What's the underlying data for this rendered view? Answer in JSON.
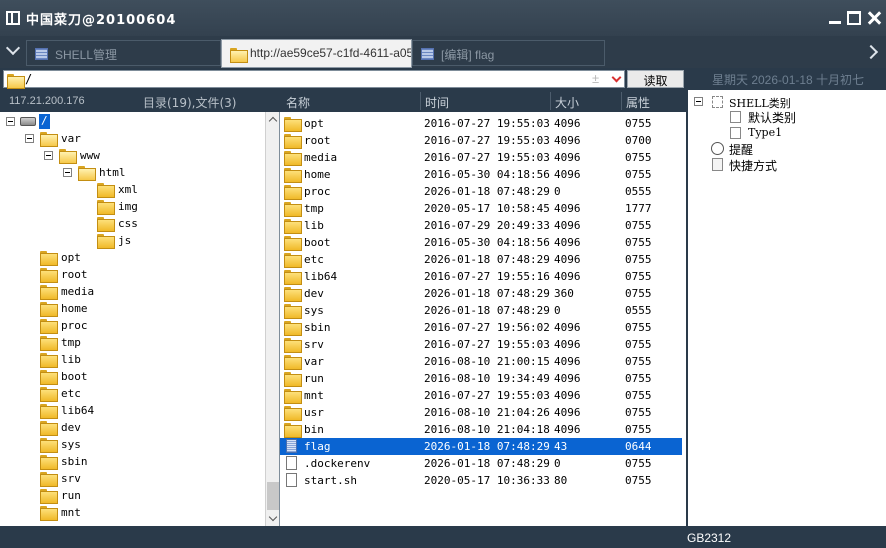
{
  "window": {
    "title": "中国菜刀@20100604"
  },
  "tabs": [
    {
      "label": "SHELL管理",
      "active": false,
      "icon": "grid-icon"
    },
    {
      "label": "http://ae59ce57-c1fd-4611-a05...",
      "active": true,
      "icon": "folder-icon"
    },
    {
      "label": "[编辑] flag",
      "active": false,
      "icon": "grid-icon"
    }
  ],
  "address": {
    "path": "/",
    "plus": "±",
    "read_label": "读取",
    "date": "星期天 2026-01-18 十月初七"
  },
  "left_header": {
    "host": "117.21.200.176",
    "summary": "目录(19),文件(3)"
  },
  "columns": {
    "name": "名称",
    "time": "时间",
    "size": "大小",
    "perm": "属性"
  },
  "tree": {
    "root": "/",
    "var": "var",
    "www": "www",
    "html": "html",
    "html_children": [
      "xml",
      "img",
      "css",
      "js"
    ],
    "root_children": [
      "opt",
      "root",
      "media",
      "home",
      "proc",
      "tmp",
      "lib",
      "boot",
      "etc",
      "lib64",
      "dev",
      "sys",
      "sbin",
      "srv",
      "run",
      "mnt"
    ]
  },
  "files": [
    {
      "name": "opt",
      "time": "2016-07-27 19:55:03",
      "size": "4096",
      "perm": "0755",
      "type": "dir"
    },
    {
      "name": "root",
      "time": "2016-07-27 19:55:03",
      "size": "4096",
      "perm": "0700",
      "type": "dir"
    },
    {
      "name": "media",
      "time": "2016-07-27 19:55:03",
      "size": "4096",
      "perm": "0755",
      "type": "dir"
    },
    {
      "name": "home",
      "time": "2016-05-30 04:18:56",
      "size": "4096",
      "perm": "0755",
      "type": "dir"
    },
    {
      "name": "proc",
      "time": "2026-01-18 07:48:29",
      "size": "0",
      "perm": "0555",
      "type": "dir"
    },
    {
      "name": "tmp",
      "time": "2020-05-17 10:58:45",
      "size": "4096",
      "perm": "1777",
      "type": "dir"
    },
    {
      "name": "lib",
      "time": "2016-07-29 20:49:33",
      "size": "4096",
      "perm": "0755",
      "type": "dir"
    },
    {
      "name": "boot",
      "time": "2016-05-30 04:18:56",
      "size": "4096",
      "perm": "0755",
      "type": "dir"
    },
    {
      "name": "etc",
      "time": "2026-01-18 07:48:29",
      "size": "4096",
      "perm": "0755",
      "type": "dir"
    },
    {
      "name": "lib64",
      "time": "2016-07-27 19:55:16",
      "size": "4096",
      "perm": "0755",
      "type": "dir"
    },
    {
      "name": "dev",
      "time": "2026-01-18 07:48:29",
      "size": "360",
      "perm": "0755",
      "type": "dir"
    },
    {
      "name": "sys",
      "time": "2026-01-18 07:48:29",
      "size": "0",
      "perm": "0555",
      "type": "dir"
    },
    {
      "name": "sbin",
      "time": "2016-07-27 19:56:02",
      "size": "4096",
      "perm": "0755",
      "type": "dir"
    },
    {
      "name": "srv",
      "time": "2016-07-27 19:55:03",
      "size": "4096",
      "perm": "0755",
      "type": "dir"
    },
    {
      "name": "var",
      "time": "2016-08-10 21:00:15",
      "size": "4096",
      "perm": "0755",
      "type": "dir"
    },
    {
      "name": "run",
      "time": "2016-08-10 19:34:49",
      "size": "4096",
      "perm": "0755",
      "type": "dir"
    },
    {
      "name": "mnt",
      "time": "2016-07-27 19:55:03",
      "size": "4096",
      "perm": "0755",
      "type": "dir"
    },
    {
      "name": "usr",
      "time": "2016-08-10 21:04:26",
      "size": "4096",
      "perm": "0755",
      "type": "dir"
    },
    {
      "name": "bin",
      "time": "2016-08-10 21:04:18",
      "size": "4096",
      "perm": "0755",
      "type": "dir"
    },
    {
      "name": "flag",
      "time": "2026-01-18 07:48:29",
      "size": "43",
      "perm": "0644",
      "type": "file",
      "selected": true
    },
    {
      "name": ".dockerenv",
      "time": "2026-01-18 07:48:29",
      "size": "0",
      "perm": "0755",
      "type": "file"
    },
    {
      "name": "start.sh",
      "time": "2020-05-17 10:36:33",
      "size": "80",
      "perm": "0755",
      "type": "file"
    }
  ],
  "right_tree": {
    "shell_category": "SHELL类别",
    "default_category": "默认类别",
    "type1": "Type1",
    "reminder": "提醒",
    "shortcut": "快捷方式"
  },
  "status": {
    "encoding": "GB2312"
  },
  "colors": {
    "chrome": "#2a3a4a",
    "selection": "#0a64d2"
  }
}
